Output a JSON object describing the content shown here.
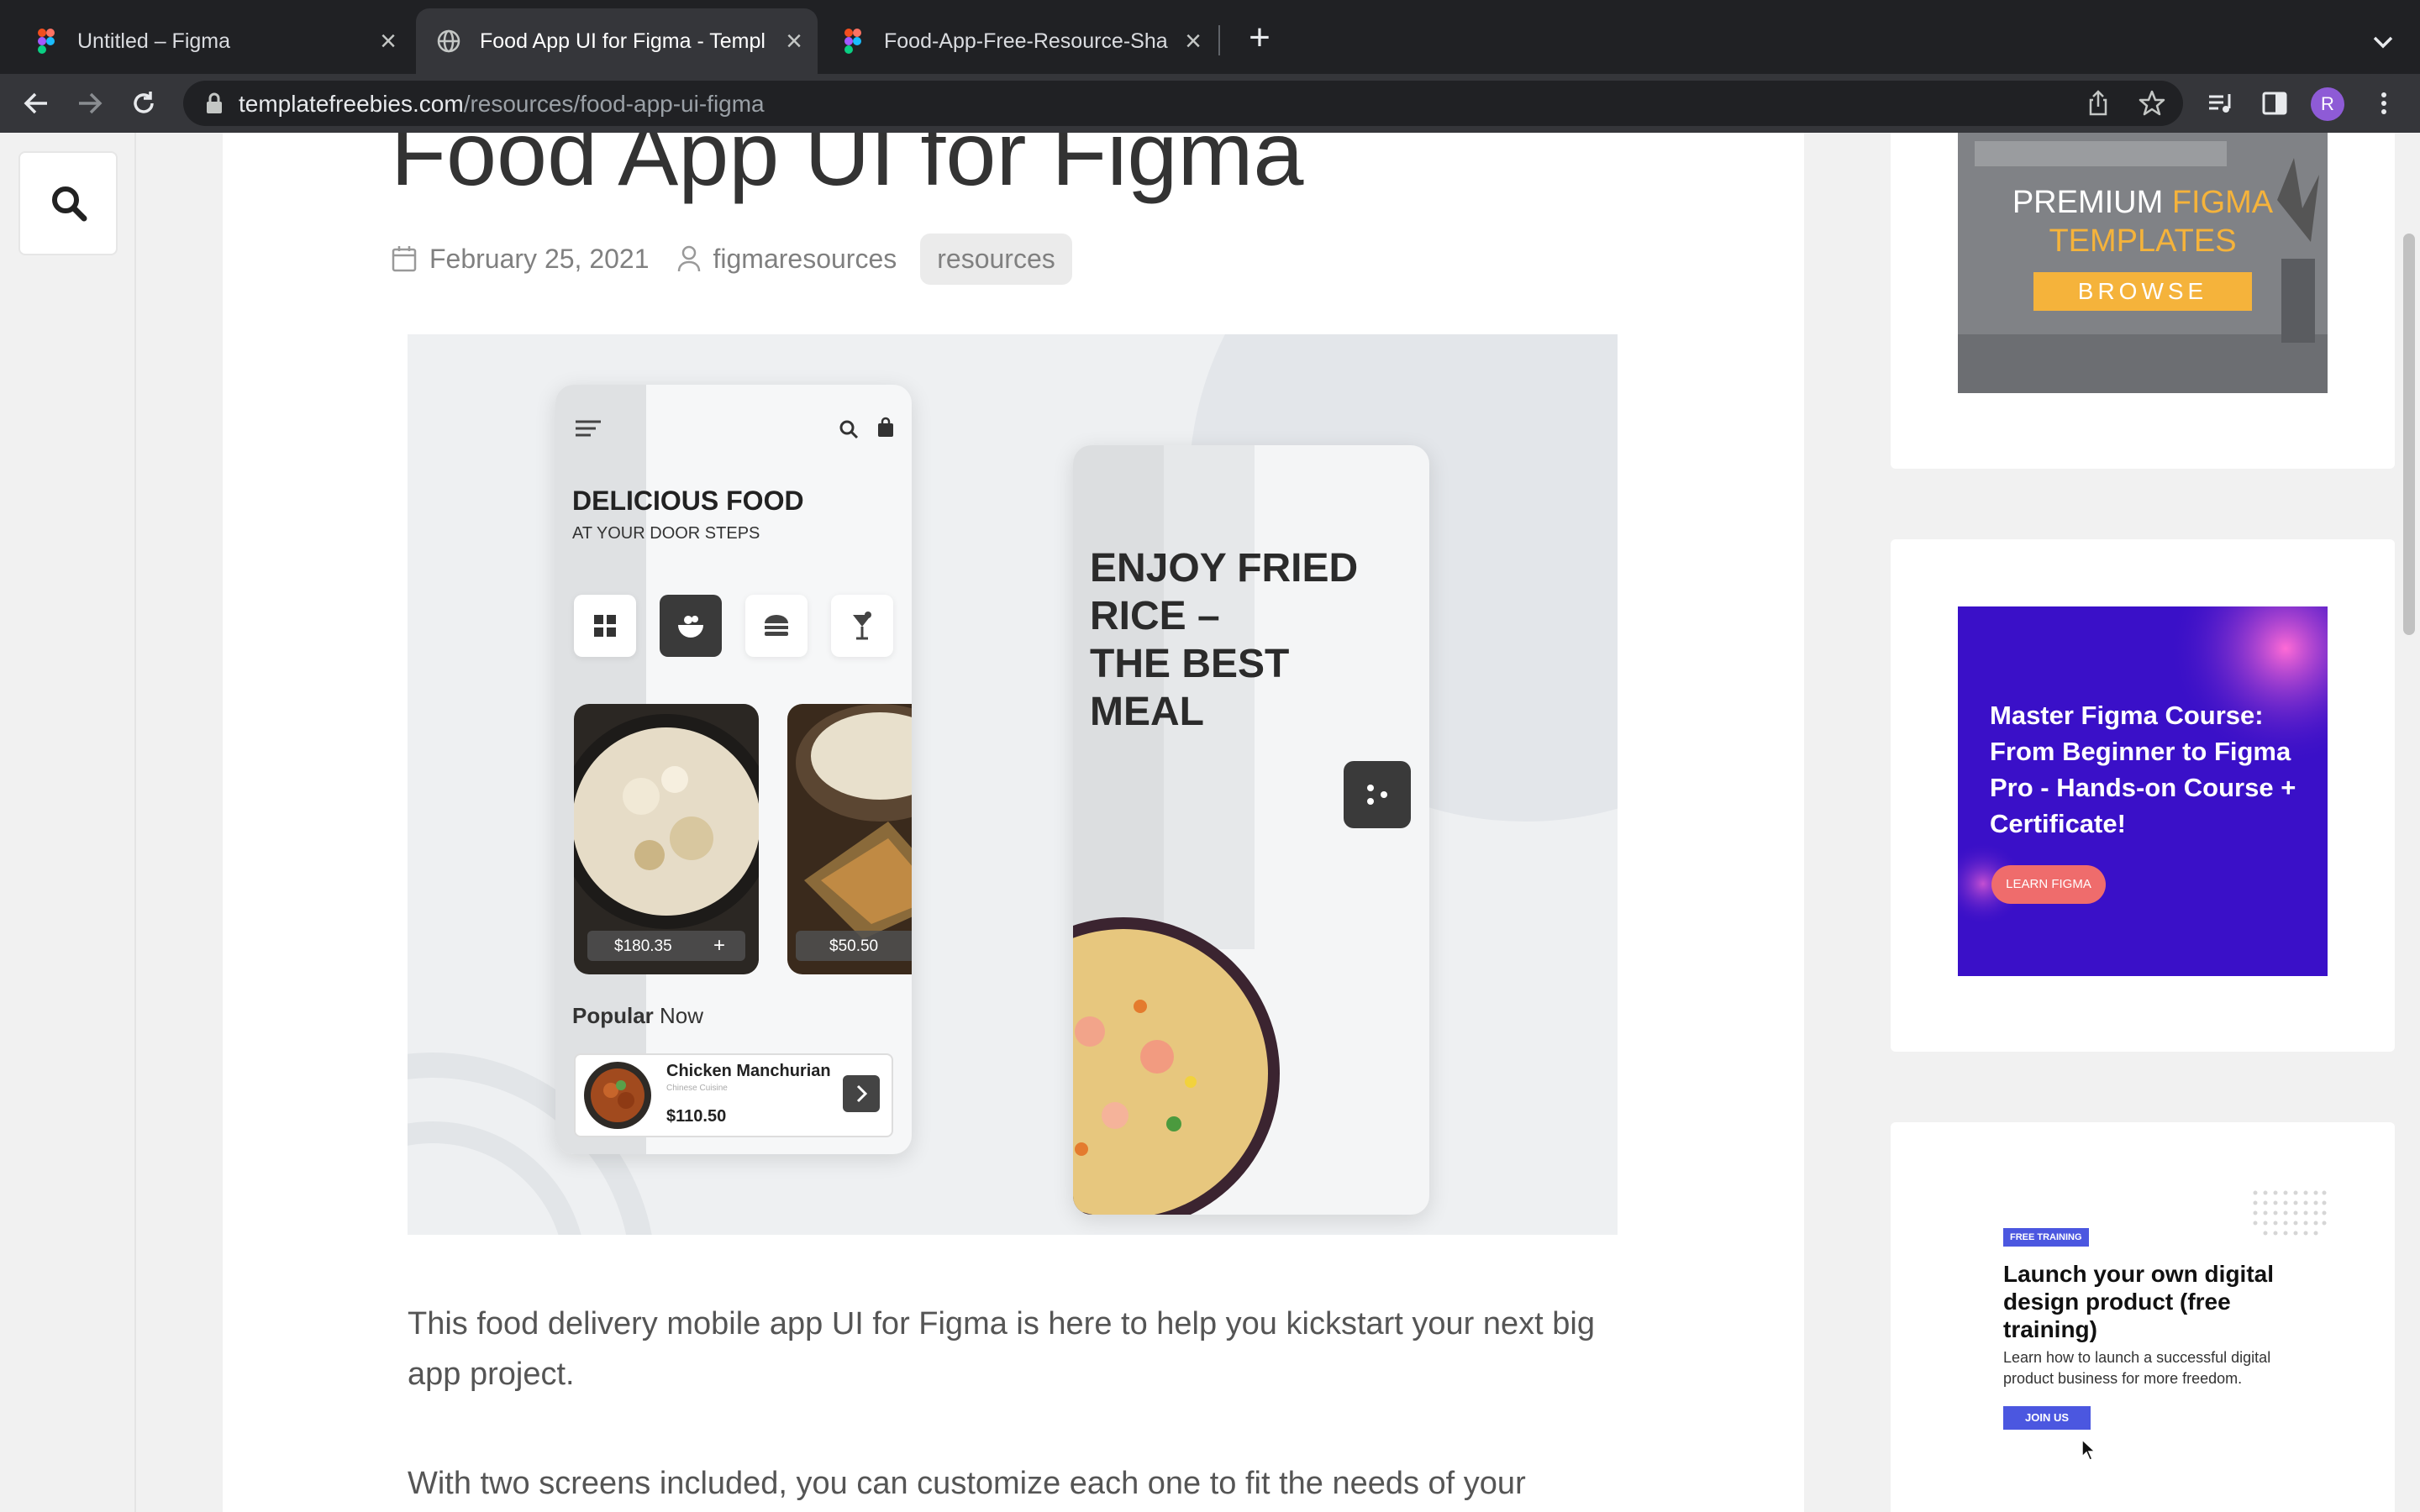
{
  "browser": {
    "tabs": [
      {
        "title": "Untitled – Figma",
        "favicon": "figma-icon",
        "active": false
      },
      {
        "title": "Food App UI for Figma - Templ",
        "favicon": "globe-icon",
        "active": true
      },
      {
        "title": "Food-App-Free-Resource-Sha",
        "favicon": "figma-icon",
        "active": false
      }
    ],
    "url_domain": "templatefreebies.com",
    "url_path": "/resources/food-app-ui-figma",
    "profile_initial": "R"
  },
  "article": {
    "title": "Food App UI for Figma",
    "date": "February 25, 2021",
    "author": "figmaresources",
    "category": "resources",
    "paragraph1": "This food delivery mobile app UI for Figma is here to help you kickstart your next big app project.",
    "paragraph2": "With two screens included, you can customize each one to fit the needs of your"
  },
  "preview": {
    "headline": "DELICIOUS FOOD",
    "subheadline": "AT YOUR DOOR STEPS",
    "price1": "$180.35",
    "price2": "$50.50",
    "popular_bold": "Popular",
    "popular_rest": "Now",
    "item_name": "Chicken Manchurian",
    "item_sub": "Chinese Cuisine",
    "item_price": "$110.50",
    "hero_line1": "ENJOY FRIED",
    "hero_line2": "RICE –",
    "hero_line3": "THE BEST",
    "hero_line4": "MEAL"
  },
  "sidebar": {
    "ad1_line1a": "PREMIUM ",
    "ad1_line1b": "FIGMA",
    "ad1_line2": "TEMPLATES",
    "ad1_button": "BROWSE",
    "ad2_text": "Master Figma Course: From Beginner to Figma Pro - Hands-on Course + Certificate!",
    "ad2_button": "LEARN FIGMA",
    "ad3_badge": "FREE TRAINING",
    "ad3_title": "Launch your own digital design product (free training)",
    "ad3_body": "Learn how to launch a successful digital product business for more freedom.",
    "ad3_button": "JOIN US"
  },
  "colors": {
    "tabbar": "#202124",
    "toolbar": "#35363a",
    "ad1_accent": "#f5b33b",
    "ad2_bg": "#3a10c8",
    "ad2_button": "#ef6c6c",
    "ad3_accent": "#4b57e0"
  }
}
